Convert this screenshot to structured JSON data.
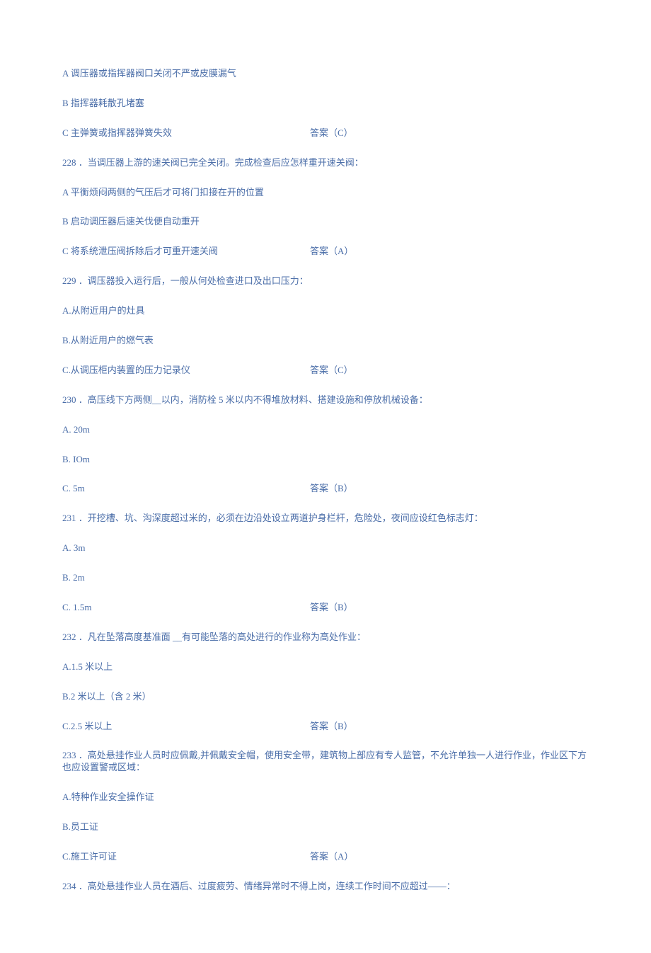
{
  "lines": [
    {
      "left": "A 调压器或指挥器阀口关闭不严或皮膜漏气",
      "right": ""
    },
    {
      "left": "B 指挥器耗散孔堵塞",
      "right": ""
    },
    {
      "left": "C 主弹簧或指挥器弹簧失效",
      "right": "答案（C）"
    },
    {
      "left": "228 ．当调压器上游的速关阀已完全关闭。完成检查后应怎样重开速关阀：",
      "right": "",
      "full": true
    },
    {
      "left": "A 平衡烦闷两侧的气压后才可将门扣接在开的位置",
      "right": ""
    },
    {
      "left": "B 启动调压器后速关伐便自动重开",
      "right": ""
    },
    {
      "left": "C 将系统泄压阀拆除后才可重开速关阀",
      "right": "答案（A）"
    },
    {
      "left": "229 ．调压器投入运行后，一般从何处检查进口及出口压力：",
      "right": "",
      "full": true
    },
    {
      "left": "A.从附近用户的灶具",
      "right": ""
    },
    {
      "left": "B.从附近用户的燃气表",
      "right": ""
    },
    {
      "left": "C.从调压柜内装置的压力记录仪",
      "right": "答案（C）"
    },
    {
      "left": "230 ．高压线下方两侧__以内，消防栓 5 米以内不得堆放材料、搭建设施和停放机械设备：",
      "right": "",
      "full": true
    },
    {
      "left": "A.  20m",
      "right": ""
    },
    {
      "left": "B.  IOm",
      "right": ""
    },
    {
      "left": "C.  5m",
      "right": "答案（B）"
    },
    {
      "left": "231 ．开挖槽、坑、沟深度超过米的，必须在边沿处设立两道护身栏杆，危险处，夜间应设红色标志灯：",
      "right": "",
      "full": true
    },
    {
      "left": "A.  3m",
      "right": ""
    },
    {
      "left": "B.  2m",
      "right": ""
    },
    {
      "left": "C.  1.5m",
      "right": "答案（B）"
    },
    {
      "left": "232 ．凡在坠落高度基准面 __有可能坠落的高处进行的作业称为高处作业：",
      "right": "",
      "full": true
    },
    {
      "left": "A.1.5 米以上",
      "right": ""
    },
    {
      "left": "B.2 米以上（含 2 米）",
      "right": ""
    },
    {
      "left": "C.2.5 米以上",
      "right": "答案（B）"
    },
    {
      "left": "233 ．高处悬挂作业人员时应佩戴,并佩戴安全帽，使用安全带，建筑物上部应有专人监管，不允许单独一人进行作业，作业区下方也应设置警戒区域：",
      "right": "",
      "full": true
    },
    {
      "left": "A.特种作业安全操作证",
      "right": ""
    },
    {
      "left": "B.员工证",
      "right": ""
    },
    {
      "left": "C.施工许可证",
      "right": "答案（A）"
    },
    {
      "left": "234 ．高处悬挂作业人员在酒后、过度疲劳、情绪异常时不得上岗，连续工作时间不应超过——：",
      "right": "",
      "full": true
    }
  ]
}
